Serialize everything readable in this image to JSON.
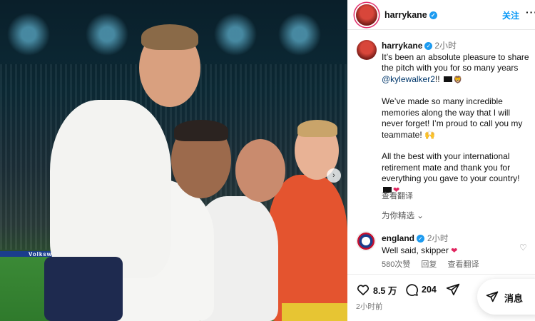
{
  "header": {
    "username": "harrykane",
    "follow_label": "关注",
    "more_label": "···"
  },
  "caption": {
    "username": "harrykane",
    "time": "2小时",
    "line1_pre": "It’s been an absolute pleasure to share the pitch with you for so many years ",
    "mention": "@kylewalker2",
    "line1_post": "!! ",
    "para2": "We’ve made so many incredible memories along the way that I will never forget! I’m proud to call you my teammate! 🙌",
    "para3": "All the best with your international retirement mate and thank you for everything you gave to your country!",
    "translate_label": "查看翻译"
  },
  "picks_label": "为你精选 ⌄",
  "comment": {
    "username": "england",
    "time": "2小时",
    "text": "Well said, skipper",
    "likes": "580次赞",
    "reply_label": "回复",
    "translate_label": "查看翻译"
  },
  "actions": {
    "likes": "8.5 万",
    "comments": "204"
  },
  "post_time": "2小时前",
  "message_label": "消息",
  "photo": {
    "board_text": "Volkswagen"
  },
  "colors": {
    "link": "#0095f6",
    "verified": "#1d9bf0",
    "heart": "#e0245e"
  }
}
